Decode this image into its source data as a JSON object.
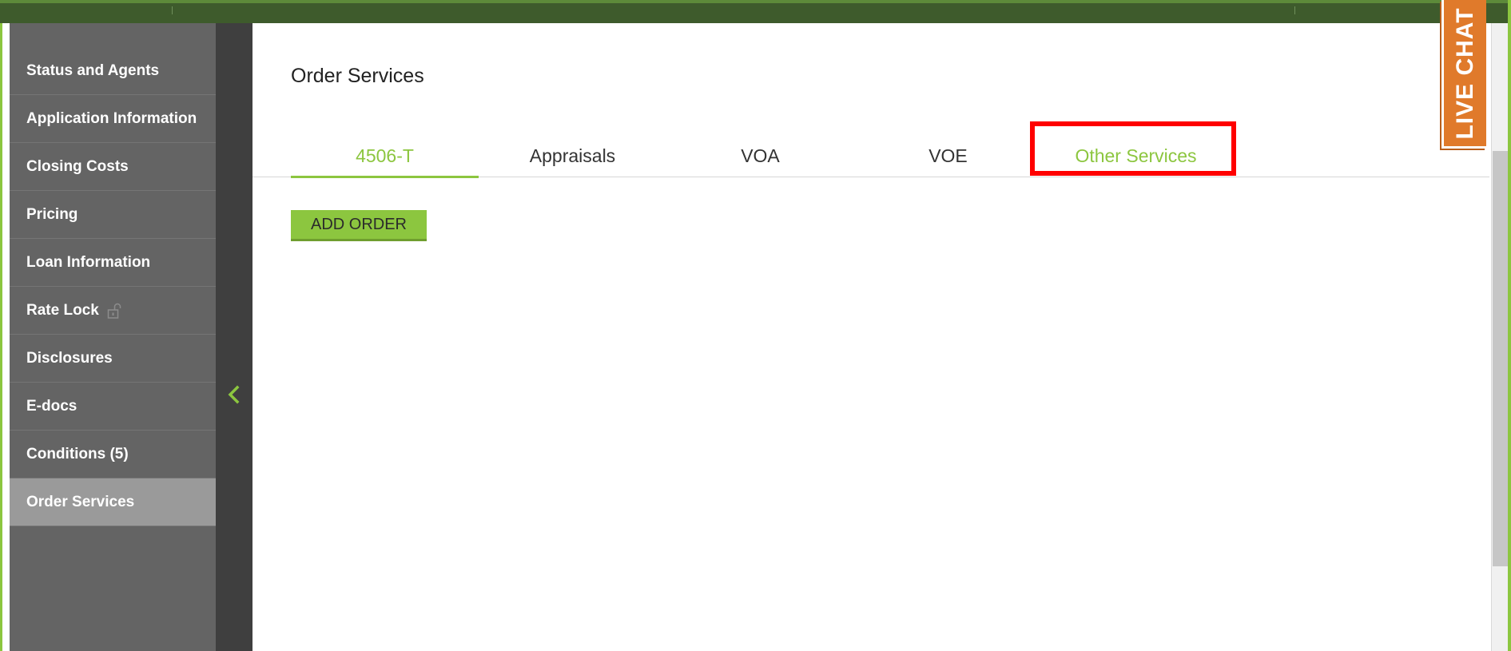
{
  "sidebar": {
    "items": [
      {
        "label": "Status and Agents"
      },
      {
        "label": "Application Information"
      },
      {
        "label": "Closing Costs"
      },
      {
        "label": "Pricing"
      },
      {
        "label": "Loan Information"
      },
      {
        "label": "Rate Lock",
        "icon": "unlocked-padlock-icon"
      },
      {
        "label": "Disclosures"
      },
      {
        "label": "E-docs"
      },
      {
        "label": "Conditions (5)"
      },
      {
        "label": "Order Services",
        "active": true
      }
    ]
  },
  "collapse_icon": "chevron-left-icon",
  "main": {
    "title": "Order Services",
    "tabs": [
      {
        "label": "4506-T",
        "active": true
      },
      {
        "label": "Appraisals"
      },
      {
        "label": "VOA"
      },
      {
        "label": "VOE"
      },
      {
        "label": "Other Services",
        "highlighted": true
      }
    ],
    "add_order_label": "ADD ORDER"
  },
  "live_chat": {
    "label": "LIVE CHAT"
  },
  "colors": {
    "accent_green": "#8cc63f",
    "topbar": "#3e5b2c",
    "sidebar": "#646464",
    "sidebar_active": "#9a9a9a",
    "rail": "#3f3f3f",
    "highlight_box": "#ff0000",
    "live_chat": "#e07a2b"
  }
}
